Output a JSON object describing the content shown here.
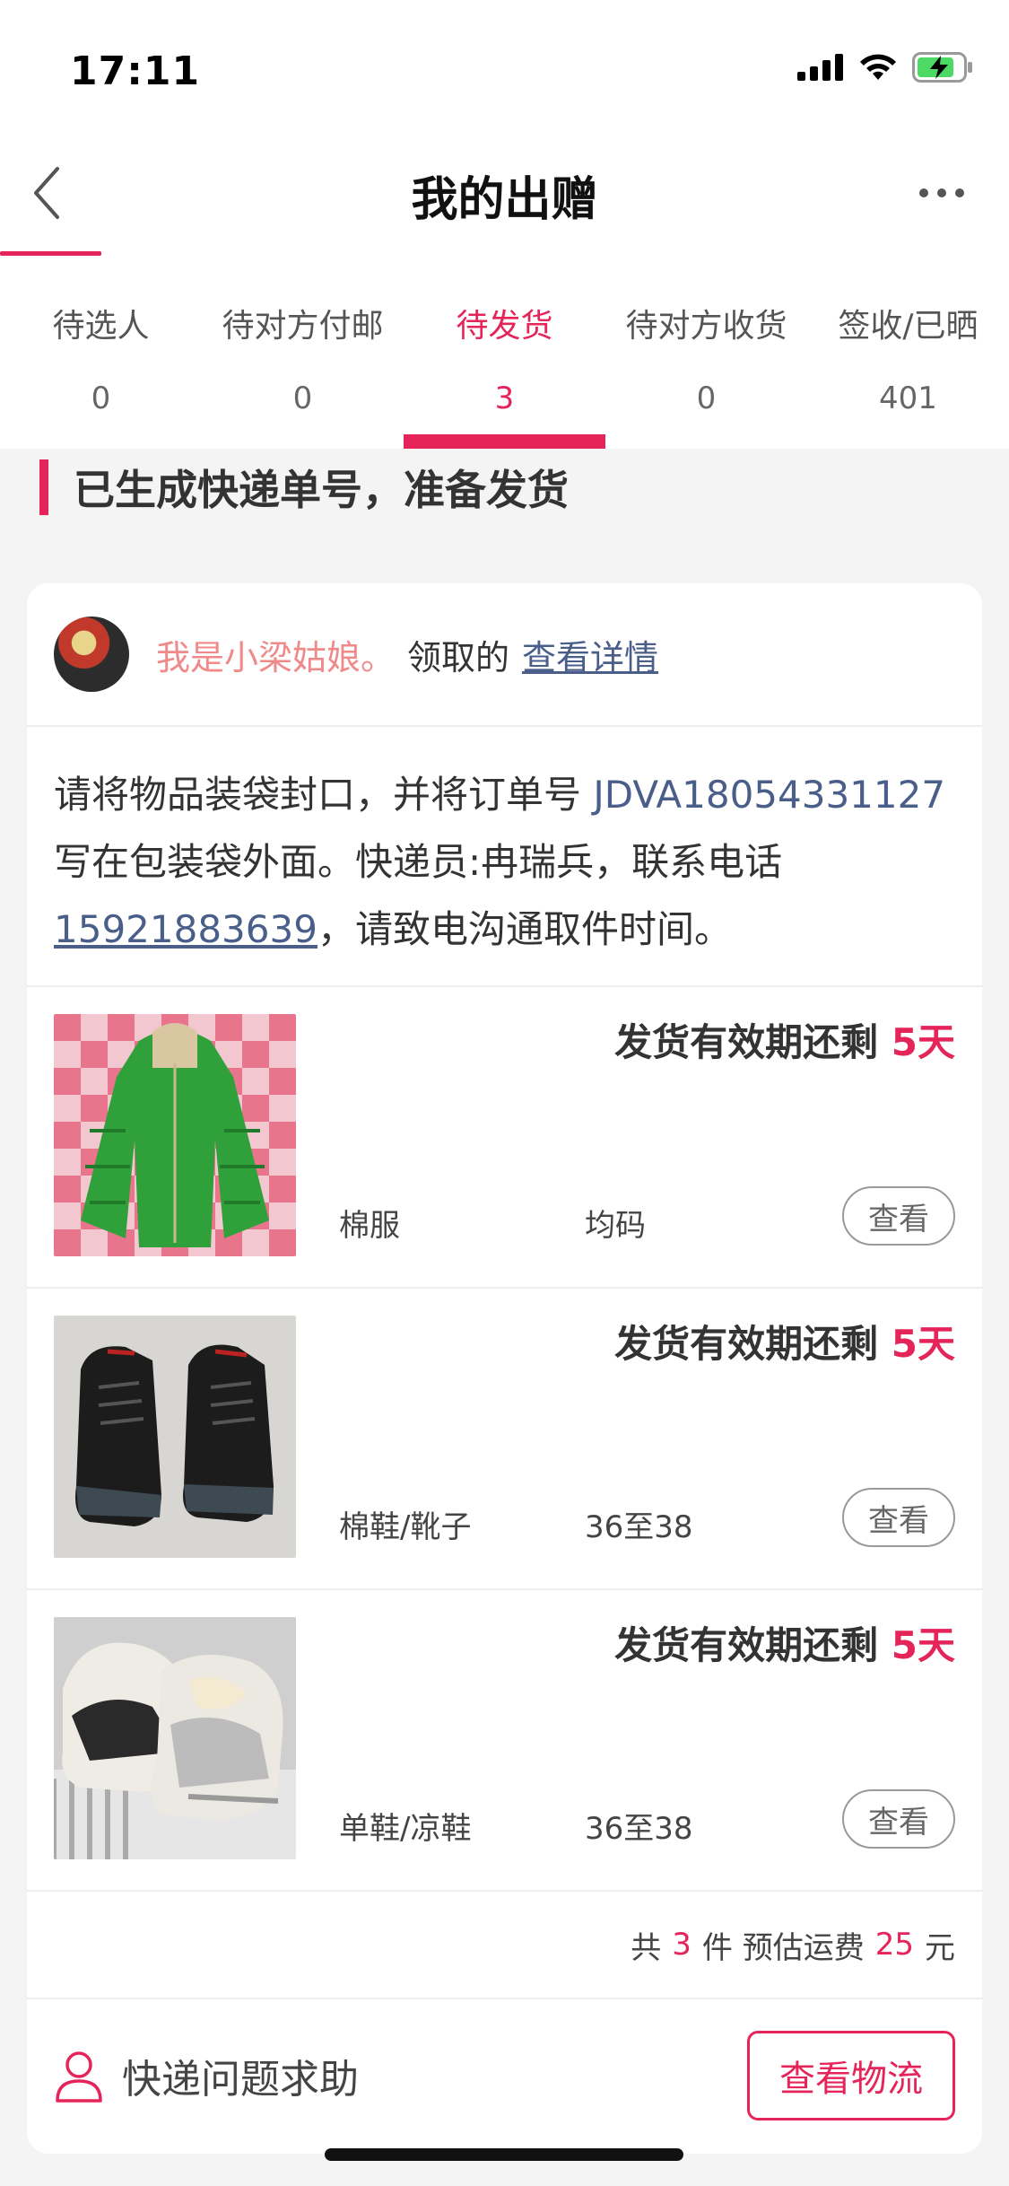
{
  "status_bar": {
    "time": "17:11"
  },
  "nav": {
    "title": "我的出赠"
  },
  "tabs": [
    {
      "label": "待选人",
      "count": "0"
    },
    {
      "label": "待对方付邮",
      "count": "0"
    },
    {
      "label": "待发货",
      "count": "3"
    },
    {
      "label": "待对方收货",
      "count": "0"
    },
    {
      "label": "签收/已晒",
      "count": "401"
    }
  ],
  "section": {
    "title": "已生成快递单号，准备发货"
  },
  "receiver": {
    "name": "我是小梁姑娘。",
    "suffix": "领取的",
    "link": "查看详情"
  },
  "instruction": {
    "part1": "请将物品装袋封口，并将订单号 ",
    "order_no": "JDVA18054331127",
    "part2": " 写在包装袋外面。快递员:冉瑞兵，联系电话",
    "phone": "15921883639",
    "part3": "，请致电沟通取件时间。"
  },
  "items": [
    {
      "deadline_label": "发货有效期还剩 ",
      "deadline_days": "5天",
      "category": "棉服",
      "size": "均码",
      "button": "查看"
    },
    {
      "deadline_label": "发货有效期还剩 ",
      "deadline_days": "5天",
      "category": "棉鞋/靴子",
      "size": "36至38",
      "button": "查看"
    },
    {
      "deadline_label": "发货有效期还剩 ",
      "deadline_days": "5天",
      "category": "单鞋/凉鞋",
      "size": "36至38",
      "button": "查看"
    }
  ],
  "summary": {
    "prefix": "共",
    "count": "3",
    "mid": "件 预估运费",
    "fee": "25",
    "unit": "元"
  },
  "footer": {
    "help_label": "快递问题求助",
    "track_button": "查看物流"
  },
  "colors": {
    "accent": "#e5245a",
    "link": "#4a5e8a"
  }
}
